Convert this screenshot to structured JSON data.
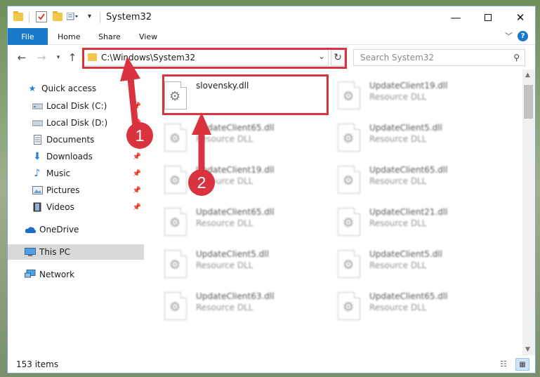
{
  "window": {
    "title": "System32",
    "controls": [
      "minimize-icon",
      "maximize-icon",
      "close-icon"
    ]
  },
  "ribbon": {
    "tabs": [
      "File",
      "Home",
      "Share",
      "View"
    ],
    "help_label": "?"
  },
  "address_bar": {
    "path": "C:\\Windows\\System32",
    "refresh_glyph": "↻"
  },
  "search": {
    "placeholder": "Search System32"
  },
  "sidebar": {
    "items": [
      {
        "label": "Quick access",
        "icon": "star-icon"
      },
      {
        "label": "Local Disk (C:)",
        "icon": "drive-icon"
      },
      {
        "label": "Local Disk (D:)",
        "icon": "drive-icon"
      },
      {
        "label": "Documents",
        "icon": "document-icon"
      },
      {
        "label": "Downloads",
        "icon": "download-arrow-icon"
      },
      {
        "label": "Music",
        "icon": "music-note-icon"
      },
      {
        "label": "Pictures",
        "icon": "pictures-icon"
      },
      {
        "label": "Videos",
        "icon": "film-icon"
      },
      {
        "label": "OneDrive",
        "icon": "cloud-icon"
      },
      {
        "label": "This PC",
        "icon": "monitor-icon"
      },
      {
        "label": "Network",
        "icon": "network-icon"
      }
    ]
  },
  "files": [
    {
      "name": "slovensky.dll",
      "type": ""
    },
    {
      "name": "UpdateClient19.dll",
      "type": "Resource DLL"
    },
    {
      "name": "UpdateClient65.dll",
      "type": "Resource DLL"
    },
    {
      "name": "UpdateClient5.dll",
      "type": "Resource DLL"
    },
    {
      "name": "UpdateClient19.dll",
      "type": "Resource DLL"
    },
    {
      "name": "UpdateClient65.dll",
      "type": "Resource DLL"
    },
    {
      "name": "UpdateClient65.dll",
      "type": "Resource DLL"
    },
    {
      "name": "UpdateClient21.dll",
      "type": "Resource DLL"
    },
    {
      "name": "UpdateClient5.dll",
      "type": "Resource DLL"
    },
    {
      "name": "UpdateClient5.dll",
      "type": "Resource DLL"
    },
    {
      "name": "UpdateClient63.dll",
      "type": "Resource DLL"
    },
    {
      "name": "UpdateClient65.dll",
      "type": "Resource DLL"
    }
  ],
  "status": {
    "item_count": "153 items"
  },
  "annotations": {
    "badge_1": "1",
    "badge_2": "2",
    "color": "#d9333f"
  }
}
